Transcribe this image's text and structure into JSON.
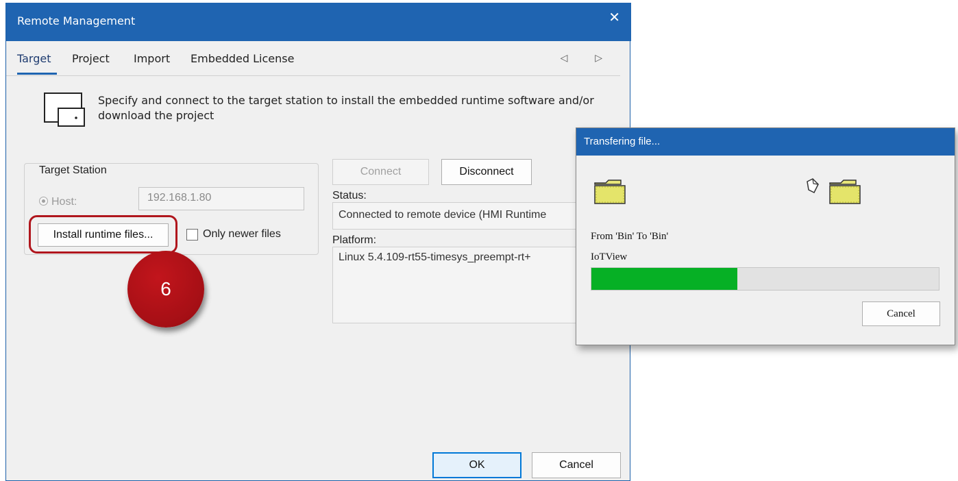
{
  "main_dialog": {
    "title": "Remote Management",
    "close_glyph": "✕",
    "tabs": [
      {
        "label": "Target",
        "active": true
      },
      {
        "label": "Project"
      },
      {
        "label": "Import"
      },
      {
        "label": "Embedded License"
      }
    ],
    "tab_scroll_arrows": "◁ ▷",
    "description": "Specify and connect to the target station to install the embedded runtime software and/or download the project",
    "description_icon": "remote-screen-icon",
    "target_station": {
      "legend": "Target Station",
      "host_label": "Host:",
      "host_selected": true,
      "host_value": "192.168.1.80",
      "install_button": "Install runtime files...",
      "only_newer_label": "Only newer files",
      "only_newer_checked": false
    },
    "connect_button": "Connect",
    "disconnect_button": "Disconnect",
    "status_label": "Status:",
    "status_value": "Connected to remote device (HMI Runtime",
    "platform_label": "Platform:",
    "platform_value": "Linux 5.4.109-rt55-timesys_preempt-rt+",
    "ok_button": "OK",
    "cancel_button": "Cancel"
  },
  "callout": {
    "number": "6",
    "color": "#a50f15"
  },
  "transfer_dialog": {
    "title": "Transfering file...",
    "from_to": "From 'Bin' To 'Bin'",
    "current_file": "IoTView",
    "progress_percent": 42,
    "cancel_button": "Cancel",
    "progress_color": "#06b025"
  },
  "colors": {
    "titlebar": "#1f64b1",
    "highlight": "#b0161d"
  }
}
